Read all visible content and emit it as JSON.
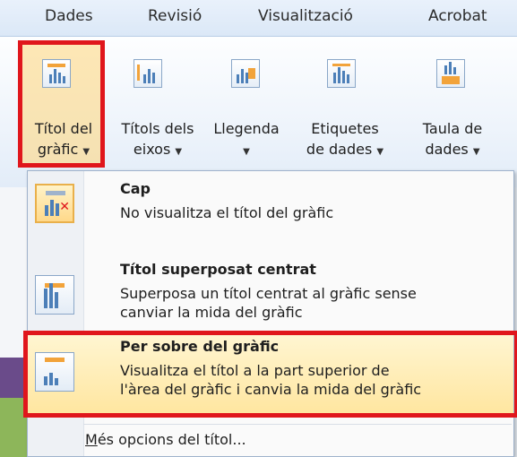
{
  "tabs": [
    "Dades",
    "Revisió",
    "Visualització",
    "Acrobat"
  ],
  "ribbon": {
    "buttons": [
      {
        "line1": "Títol del",
        "line2": "gràfic",
        "icon": "chart-title-icon"
      },
      {
        "line1": "Títols dels",
        "line2": "eixos",
        "icon": "axis-titles-icon"
      },
      {
        "line1": "Llegenda",
        "line2": "",
        "icon": "legend-icon"
      },
      {
        "line1": "Etiquetes",
        "line2": "de dades",
        "icon": "data-labels-icon"
      },
      {
        "line1": "Taula de",
        "line2": "dades",
        "icon": "data-table-icon"
      }
    ],
    "arrow": "▼"
  },
  "menu": {
    "items": [
      {
        "title": "Cap",
        "desc1": "No visualitza el títol del gràfic",
        "desc2": "",
        "icon": "no-title-icon"
      },
      {
        "title": "Títol superposat centrat",
        "desc1": "Superposa un títol centrat al gràfic sense",
        "desc2": "canviar la mida del gràfic",
        "icon": "overlay-title-icon"
      },
      {
        "title": "Per sobre del gràfic",
        "desc1": "Visualitza el títol a la part superior de",
        "desc2": "l'àrea del gràfic i canvia la mida del gràfic",
        "icon": "above-chart-title-icon"
      }
    ],
    "more_first": "M",
    "more_rest": "és opcions del títol..."
  },
  "colors": {
    "highlight": "#e0161c",
    "accent": "#f2a33a",
    "bars": "#4c7fb8"
  }
}
